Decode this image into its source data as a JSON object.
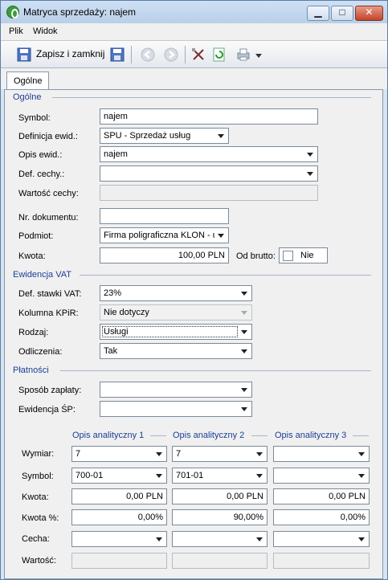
{
  "window": {
    "title": "Matryca sprzedaży: najem"
  },
  "menu": {
    "plik": "Plik",
    "widok": "Widok"
  },
  "toolbar": {
    "save_close": "Zapisz i zamknij"
  },
  "tabs": {
    "ogolne": "Ogólne"
  },
  "sections": {
    "ogolne": "Ogólne",
    "vat": "Ewidencja VAT",
    "platnosci": "Płatności"
  },
  "ogolne": {
    "symbol_label": "Symbol:",
    "symbol": "najem",
    "definicja_label": "Definicja ewid.:",
    "definicja": "SPU - Sprzedaż usług",
    "opis_label": "Opis ewid.:",
    "opis": "najem",
    "cechy_label": "Def. cechy.:",
    "cechy": "",
    "wartosc_cechy_label": "Wartość cechy:",
    "wartosc_cechy": "",
    "nr_dok_label": "Nr. dokumentu:",
    "nr_dok": "",
    "podmiot_label": "Podmiot:",
    "podmiot": "Firma poligraficzna KLON - us",
    "kwota_label": "Kwota:",
    "kwota": "100,00 PLN",
    "od_brutto_label": "Od brutto:",
    "od_brutto_value": "Nie"
  },
  "vat": {
    "stawka_label": "Def. stawki VAT:",
    "stawka": "23%",
    "kpir_label": "Kolumna KPiR:",
    "kpir": "Nie dotyczy",
    "rodzaj_label": "Rodzaj:",
    "rodzaj": "Usługi",
    "odliczenia_label": "Odliczenia:",
    "odliczenia": "Tak"
  },
  "platnosci": {
    "sposob_label": "Sposób zapłaty:",
    "sposob": "",
    "sp_label": "Ewidencja ŚP:",
    "sp": ""
  },
  "opisy": {
    "headers": [
      "Opis analityczny 1",
      "Opis analityczny 2",
      "Opis analityczny 3"
    ],
    "labels": {
      "wymiar": "Wymiar:",
      "symbol": "Symbol:",
      "kwota": "Kwota:",
      "kwota_proc": "Kwota %:",
      "cecha": "Cecha:",
      "wartosc": "Wartość:"
    },
    "wymiar": [
      "7",
      "7",
      ""
    ],
    "symbol": [
      "700-01",
      "701-01",
      ""
    ],
    "kwota": [
      "0,00 PLN",
      "0,00 PLN",
      "0,00 PLN"
    ],
    "kwota_proc": [
      "0,00%",
      "90,00%",
      "0,00%"
    ],
    "cecha": [
      "",
      "",
      ""
    ]
  }
}
